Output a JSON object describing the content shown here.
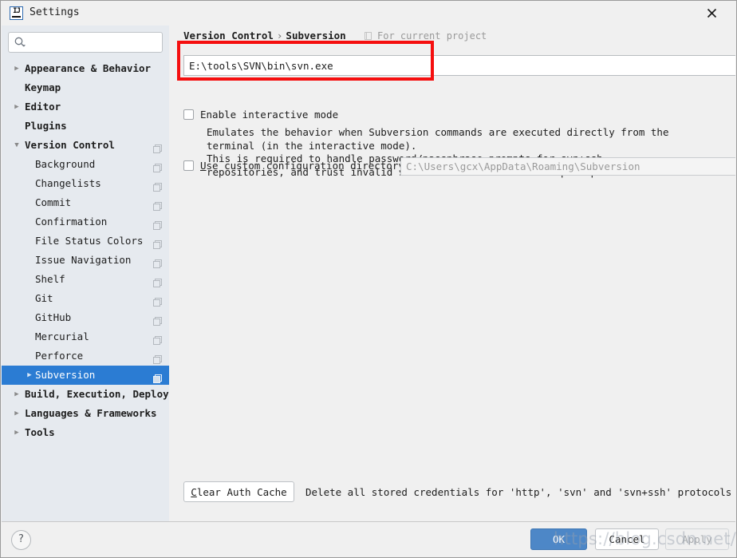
{
  "window": {
    "title": "Settings",
    "app_icon": "intellij-idea-icon",
    "close_label": "×"
  },
  "sidebar": {
    "search": {
      "value": "",
      "placeholder": ""
    },
    "items": [
      {
        "label": "Appearance & Behavior",
        "level": 0,
        "twisty": "collapsed",
        "scope_icon": false,
        "selected": false
      },
      {
        "label": "Keymap",
        "level": 0,
        "twisty": "none",
        "scope_icon": false,
        "selected": false
      },
      {
        "label": "Editor",
        "level": 0,
        "twisty": "collapsed",
        "scope_icon": false,
        "selected": false
      },
      {
        "label": "Plugins",
        "level": 0,
        "twisty": "none",
        "scope_icon": false,
        "selected": false
      },
      {
        "label": "Version Control",
        "level": 0,
        "twisty": "expanded",
        "scope_icon": true,
        "selected": false
      },
      {
        "label": "Background",
        "level": 1,
        "twisty": "none",
        "scope_icon": true,
        "selected": false
      },
      {
        "label": "Changelists",
        "level": 1,
        "twisty": "none",
        "scope_icon": true,
        "selected": false
      },
      {
        "label": "Commit",
        "level": 1,
        "twisty": "none",
        "scope_icon": true,
        "selected": false
      },
      {
        "label": "Confirmation",
        "level": 1,
        "twisty": "none",
        "scope_icon": true,
        "selected": false
      },
      {
        "label": "File Status Colors",
        "level": 1,
        "twisty": "none",
        "scope_icon": true,
        "selected": false
      },
      {
        "label": "Issue Navigation",
        "level": 1,
        "twisty": "none",
        "scope_icon": true,
        "selected": false
      },
      {
        "label": "Shelf",
        "level": 1,
        "twisty": "none",
        "scope_icon": true,
        "selected": false
      },
      {
        "label": "Git",
        "level": 1,
        "twisty": "none",
        "scope_icon": true,
        "selected": false
      },
      {
        "label": "GitHub",
        "level": 1,
        "twisty": "none",
        "scope_icon": true,
        "selected": false
      },
      {
        "label": "Mercurial",
        "level": 1,
        "twisty": "none",
        "scope_icon": true,
        "selected": false
      },
      {
        "label": "Perforce",
        "level": 1,
        "twisty": "none",
        "scope_icon": true,
        "selected": false
      },
      {
        "label": "Subversion",
        "level": 1,
        "twisty": "collapsed",
        "scope_icon": true,
        "selected": true
      },
      {
        "label": "Build, Execution, Deployment",
        "level": 0,
        "twisty": "collapsed",
        "scope_icon": false,
        "selected": false
      },
      {
        "label": "Languages & Frameworks",
        "level": 0,
        "twisty": "collapsed",
        "scope_icon": false,
        "selected": false
      },
      {
        "label": "Tools",
        "level": 0,
        "twisty": "collapsed",
        "scope_icon": false,
        "selected": false
      }
    ]
  },
  "main": {
    "breadcrumb": {
      "root": "Version Control",
      "separator": "›",
      "leaf": "Subversion"
    },
    "scope_note": {
      "icon": "project-scope-icon",
      "text": "For current project"
    },
    "svn_path": {
      "value": "E:\\tools\\SVN\\bin\\svn.exe",
      "placeholder": ""
    },
    "interactive_mode": {
      "label": "Enable interactive mode",
      "checked": false,
      "description": "Emulates the behavior when Subversion commands are executed directly from the\nterminal (in the interactive mode).\nThis is required to handle password/passphrase prompts for svn+ssh\nrepositories, and trust invalid server certificates for https repositories."
    },
    "custom_config": {
      "label_prefix": "",
      "label_mnemonic": "U",
      "label_suffix": "se custom configuration directory:",
      "checked": false,
      "value": "C:\\Users\\gcx\\AppData\\Roaming\\Subversion",
      "enabled": false
    },
    "clear_cache": {
      "mnemonic": "C",
      "label_rest": "lear Auth Cache",
      "description": "Delete all stored credentials for 'http', 'svn' and 'svn+ssh' protocols"
    }
  },
  "footer": {
    "help_label": "?",
    "ok_label": "OK",
    "cancel_label": "Cancel",
    "apply_label": "Apply"
  },
  "annotation": {
    "highlight_color": "#f50f0f"
  },
  "watermark": {
    "text": "https://blog.csdn.net/v_img"
  }
}
